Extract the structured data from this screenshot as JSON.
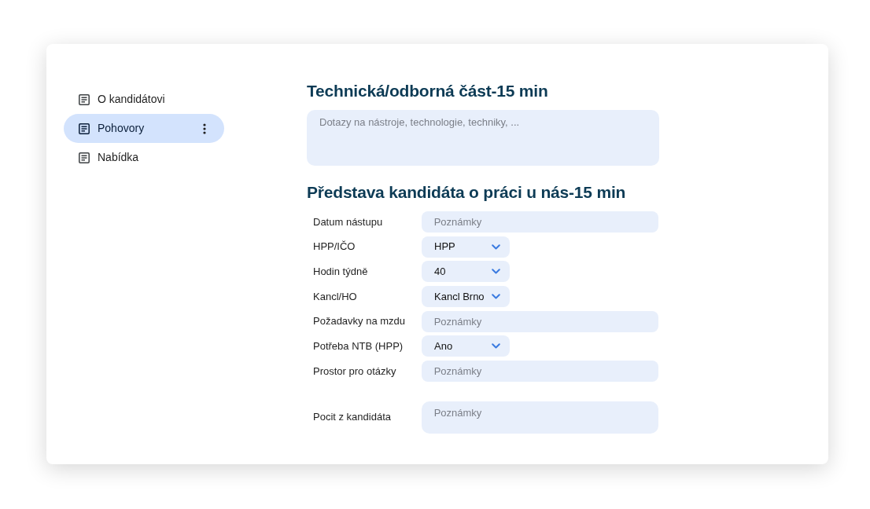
{
  "sidebar": {
    "items": [
      {
        "label": "O kandidátovi",
        "selected": false
      },
      {
        "label": "Pohovory",
        "selected": true
      },
      {
        "label": "Nabídka",
        "selected": false
      }
    ]
  },
  "sections": [
    {
      "title": "Technická/odborná část-15 min",
      "fields": [
        {
          "kind": "textarea",
          "placeholder": "Dotazy na nástroje, technologie, techniky, ..."
        }
      ]
    },
    {
      "title": "Představa kandidáta o práci u nás-15 min",
      "fields": [
        {
          "label": "Datum nástupu",
          "kind": "text",
          "placeholder": "Poznámky"
        },
        {
          "label": "HPP/IČO",
          "kind": "select",
          "value": "HPP"
        },
        {
          "label": "Hodin týdně",
          "kind": "select",
          "value": "40"
        },
        {
          "label": "Kancl/HO",
          "kind": "select",
          "value": "Kancl Brno"
        },
        {
          "label": "Požadavky na mzdu",
          "kind": "text",
          "placeholder": "Poznámky"
        },
        {
          "label": "Potřeba NTB (HPP)",
          "kind": "select",
          "value": "Ano"
        },
        {
          "label": "Prostor pro otázky",
          "kind": "text",
          "placeholder": "Poznámky"
        },
        {
          "label": "Pocit z kandidáta",
          "kind": "textarea",
          "placeholder": "Poznámky"
        }
      ]
    }
  ]
}
